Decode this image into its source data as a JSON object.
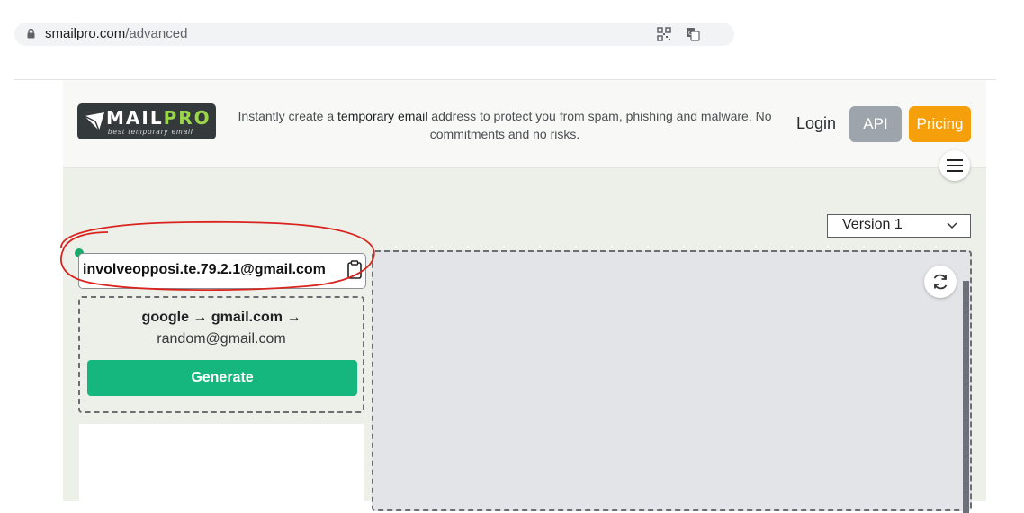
{
  "browser": {
    "url_host": "smailpro.com",
    "url_path": "/advanced"
  },
  "header": {
    "logo_word_main": "MAIL",
    "logo_word_accent": "PRO",
    "logo_word_prefix": "S",
    "logo_tagline": "best temporary email",
    "tagline_before": "Instantly create a ",
    "tagline_bold": "temporary email",
    "tagline_after": " address to protect you from spam, phishing and malware. No commitments and no risks.",
    "login_label": "Login",
    "api_label": "API",
    "pricing_label": "Pricing"
  },
  "version_select": {
    "selected": "Version 1"
  },
  "email": {
    "address": "involveopposi.te.79.2.1@gmail.com"
  },
  "generator": {
    "line1": "google → gmail.com →",
    "line2": "random@gmail.com",
    "button_label": "Generate"
  },
  "colors": {
    "accent_green": "#16b77f",
    "pricing_orange": "#f59f0b",
    "api_gray": "#9ea4ab",
    "annotation_red": "#d9231f"
  }
}
